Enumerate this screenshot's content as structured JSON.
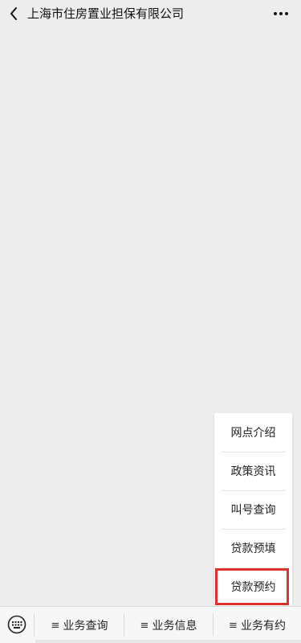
{
  "header": {
    "title": "上海市住房置业担保有限公司",
    "back_icon": "chevron-left-icon",
    "more_icon": "more-dots-icon"
  },
  "popup_menu": {
    "items": [
      {
        "label": "网点介绍"
      },
      {
        "label": "政策资讯"
      },
      {
        "label": "叫号查询"
      },
      {
        "label": "贷款预填"
      },
      {
        "label": "贷款预约",
        "highlighted": true
      }
    ],
    "highlight_color": "#e03131"
  },
  "bottom_bar": {
    "keyboard_icon": "keyboard-icon",
    "tabs": [
      {
        "glyph": "≡",
        "label": "业务查询"
      },
      {
        "glyph": "≡",
        "label": "业务信息"
      },
      {
        "glyph": "≡",
        "label": "业务有约"
      }
    ]
  }
}
